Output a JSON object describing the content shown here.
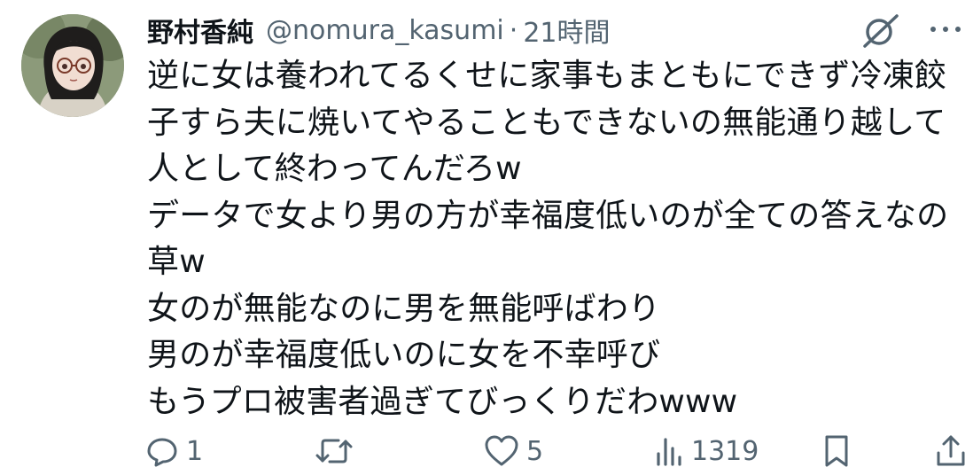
{
  "tweet": {
    "display_name": "野村香純",
    "handle": "@nomura_kasumi",
    "separator": "·",
    "timestamp": "21時間",
    "lines": [
      "逆に女は養われてるくせに家事もまともにできず冷凍餃",
      "子すら夫に焼いてやることもできないの無能通り越して",
      "人として終わってんだろw",
      "データで女より男の方が幸福度低いのが全ての答えなの",
      "草w",
      "女のが無能なのに男を無能呼ばわり",
      "男のが幸福度低いのに女を不幸呼び",
      "もうプロ被害者過ぎてびっくりだわwww"
    ]
  },
  "actions": {
    "reply_count": "1",
    "retweet_count": "",
    "like_count": "5",
    "views_count": "1319"
  },
  "icons": {
    "reply": "speech-bubble-icon",
    "retweet": "repost-arrows-icon",
    "like": "heart-icon",
    "views": "bar-chart-icon",
    "bookmark": "bookmark-icon",
    "share": "share-upload-icon",
    "grok": "grok-slash-circle-icon",
    "more": "ellipsis-icon"
  },
  "colors": {
    "text": "#0f1419",
    "secondary": "#536471",
    "background": "#ffffff"
  }
}
